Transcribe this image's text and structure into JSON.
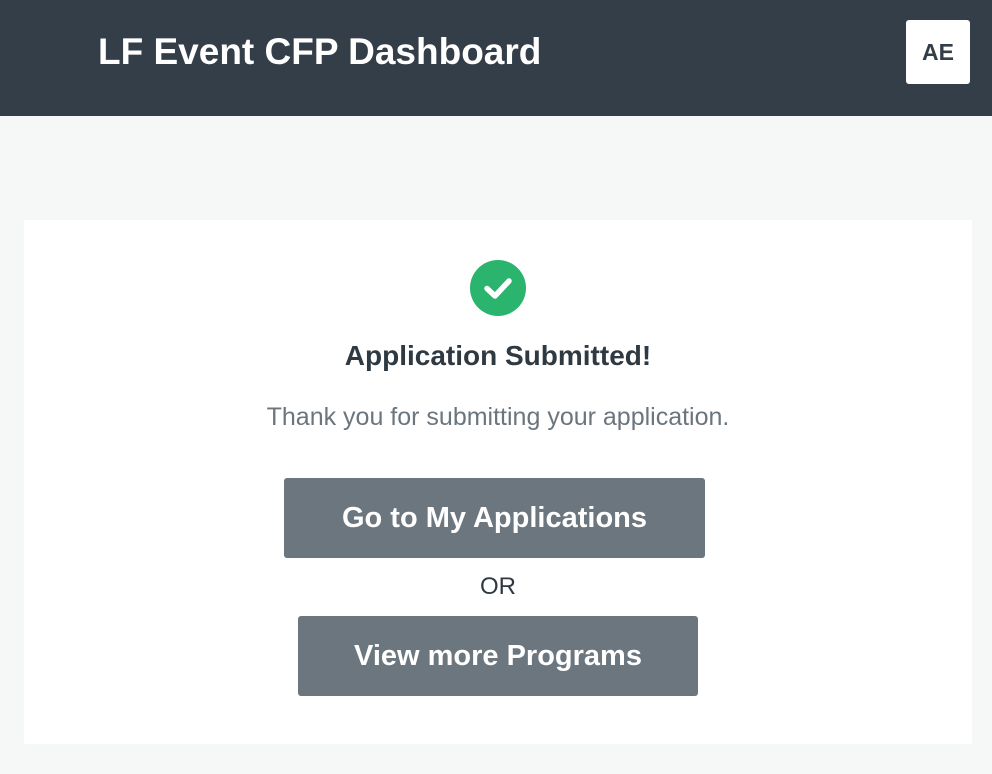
{
  "header": {
    "title": "LF Event CFP Dashboard",
    "avatar_initials": "AE"
  },
  "confirmation": {
    "icon": "check-circle-icon",
    "heading": "Application Submitted!",
    "message": "Thank you for submitting your application.",
    "primary_button_label": "Go to My Applications",
    "separator": "OR",
    "secondary_button_label": "View more Programs"
  },
  "colors": {
    "header_bg": "#343e48",
    "page_bg": "#f6f7f7",
    "success": "#2ab46e",
    "button_bg": "#6b767e",
    "text_dark": "#2f3942",
    "text_muted": "#6b757d"
  }
}
